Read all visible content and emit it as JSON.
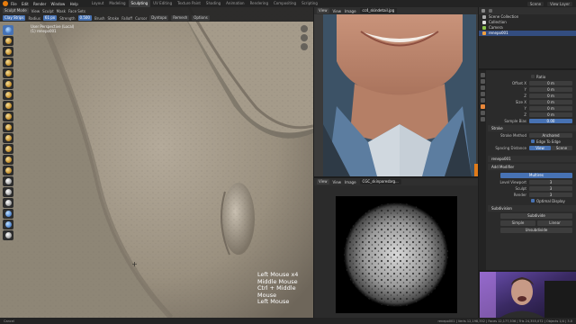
{
  "topbar": {
    "menus": [
      "File",
      "Edit",
      "Render",
      "Window",
      "Help"
    ],
    "workspaces": [
      "Layout",
      "Modeling",
      "Sculpting",
      "UV Editing",
      "Texture Paint",
      "Shading",
      "Animation",
      "Rendering",
      "Compositing",
      "Scripting"
    ],
    "active_workspace": "Sculpting",
    "scene_label": "Scene",
    "view_layer_label": "View Layer"
  },
  "viewport": {
    "mode": "Sculpt Mode",
    "menus": [
      "View",
      "Sculpt",
      "Mask",
      "Face Sets"
    ],
    "tool_row": [
      "Brush",
      "Stroke",
      "Falloff",
      "Cursor"
    ],
    "brush_name": "Clay Strips",
    "radius_label": "Radius",
    "radius_value": "61 px",
    "strength_label": "Strength",
    "strength_value": "0.500",
    "dyntopo_label": "Dyntopo",
    "remesh_label": "Remesh",
    "options_label": "Options",
    "info_line1": "User Perspective (Local)",
    "info_line2": "(1) renepo001",
    "shortcuts": [
      "Left Mouse x4",
      "Middle Mouse",
      "Ctrl + Middle Mouse",
      "Left Mouse"
    ],
    "skin_color": "#8a8173"
  },
  "image_editor_top": {
    "menus": [
      "View",
      "View",
      "Image"
    ],
    "filename": "cc4_skindetail.jpg"
  },
  "image_editor_bottom": {
    "menus": [
      "View",
      "View",
      "Image"
    ],
    "filename": "CGC_skinporesbrg..."
  },
  "outliner": {
    "rows": [
      {
        "label": "Scene Collection",
        "selected": false
      },
      {
        "label": "Collection",
        "selected": false
      },
      {
        "label": "Camera",
        "selected": false
      },
      {
        "label": "renepo001",
        "selected": true
      }
    ]
  },
  "properties": {
    "tiling_section": [
      {
        "k": "Offset X",
        "v": "0 m"
      },
      {
        "k": "Y",
        "v": "0 m"
      },
      {
        "k": "Z",
        "v": "0 m"
      },
      {
        "k": "Size X",
        "v": "0 m"
      },
      {
        "k": "Y",
        "v": "0 m"
      },
      {
        "k": "Z",
        "v": "0 m"
      }
    ],
    "ratio_label": "Ratio",
    "sample_bias_label": "Sample Bias",
    "sample_bias_value": "0.00",
    "stroke_section": "Stroke",
    "stroke_method_label": "Stroke Method",
    "stroke_method_value": "Anchored",
    "edge_to_edge_label": "Edge To Edge",
    "spacing_label": "Spacing Distance",
    "spacing_view": "View",
    "spacing_scene": "Scene",
    "object_name": "renepo001",
    "add_modifier": "Add Modifier",
    "modifier_name": "Multires",
    "levels_viewport_label": "Level Viewport",
    "levels_viewport_value": "3",
    "sculpt_label": "Sculpt",
    "sculpt_value": "3",
    "render_label": "Render",
    "render_value": "3",
    "optimal_display": "Optimal Display",
    "subdivision_section": "Subdivision",
    "subdivide_btn": "Subdivide",
    "simple_btn": "Simple",
    "linear_btn": "Linear",
    "unsubdivide_btn": "Unsubdivide"
  },
  "statusbar": {
    "left": "Cancel",
    "right": "renepo001 | Verts 12,198,352 | Faces 12,177,536 | Tris 24,355,072 | Objects 1/4 | 3.0"
  }
}
